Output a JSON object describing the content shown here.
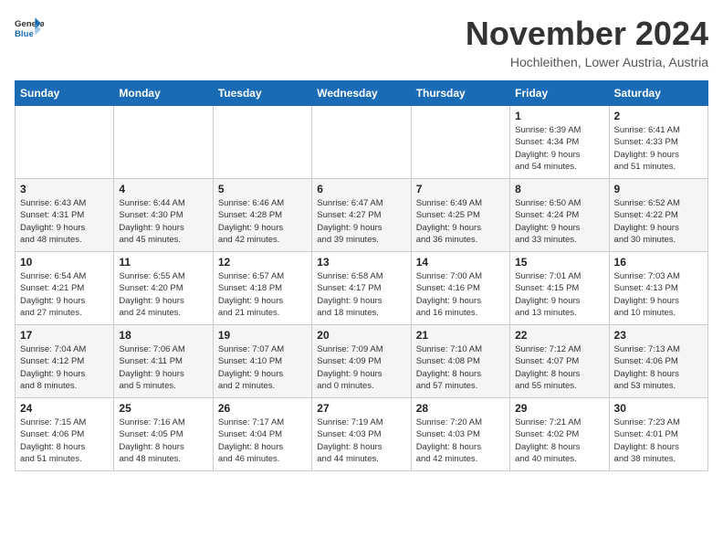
{
  "logo": {
    "line1": "General",
    "line2": "Blue"
  },
  "title": "November 2024",
  "location": "Hochleithen, Lower Austria, Austria",
  "weekdays": [
    "Sunday",
    "Monday",
    "Tuesday",
    "Wednesday",
    "Thursday",
    "Friday",
    "Saturday"
  ],
  "weeks": [
    [
      {
        "day": "",
        "info": ""
      },
      {
        "day": "",
        "info": ""
      },
      {
        "day": "",
        "info": ""
      },
      {
        "day": "",
        "info": ""
      },
      {
        "day": "",
        "info": ""
      },
      {
        "day": "1",
        "info": "Sunrise: 6:39 AM\nSunset: 4:34 PM\nDaylight: 9 hours\nand 54 minutes."
      },
      {
        "day": "2",
        "info": "Sunrise: 6:41 AM\nSunset: 4:33 PM\nDaylight: 9 hours\nand 51 minutes."
      }
    ],
    [
      {
        "day": "3",
        "info": "Sunrise: 6:43 AM\nSunset: 4:31 PM\nDaylight: 9 hours\nand 48 minutes."
      },
      {
        "day": "4",
        "info": "Sunrise: 6:44 AM\nSunset: 4:30 PM\nDaylight: 9 hours\nand 45 minutes."
      },
      {
        "day": "5",
        "info": "Sunrise: 6:46 AM\nSunset: 4:28 PM\nDaylight: 9 hours\nand 42 minutes."
      },
      {
        "day": "6",
        "info": "Sunrise: 6:47 AM\nSunset: 4:27 PM\nDaylight: 9 hours\nand 39 minutes."
      },
      {
        "day": "7",
        "info": "Sunrise: 6:49 AM\nSunset: 4:25 PM\nDaylight: 9 hours\nand 36 minutes."
      },
      {
        "day": "8",
        "info": "Sunrise: 6:50 AM\nSunset: 4:24 PM\nDaylight: 9 hours\nand 33 minutes."
      },
      {
        "day": "9",
        "info": "Sunrise: 6:52 AM\nSunset: 4:22 PM\nDaylight: 9 hours\nand 30 minutes."
      }
    ],
    [
      {
        "day": "10",
        "info": "Sunrise: 6:54 AM\nSunset: 4:21 PM\nDaylight: 9 hours\nand 27 minutes."
      },
      {
        "day": "11",
        "info": "Sunrise: 6:55 AM\nSunset: 4:20 PM\nDaylight: 9 hours\nand 24 minutes."
      },
      {
        "day": "12",
        "info": "Sunrise: 6:57 AM\nSunset: 4:18 PM\nDaylight: 9 hours\nand 21 minutes."
      },
      {
        "day": "13",
        "info": "Sunrise: 6:58 AM\nSunset: 4:17 PM\nDaylight: 9 hours\nand 18 minutes."
      },
      {
        "day": "14",
        "info": "Sunrise: 7:00 AM\nSunset: 4:16 PM\nDaylight: 9 hours\nand 16 minutes."
      },
      {
        "day": "15",
        "info": "Sunrise: 7:01 AM\nSunset: 4:15 PM\nDaylight: 9 hours\nand 13 minutes."
      },
      {
        "day": "16",
        "info": "Sunrise: 7:03 AM\nSunset: 4:13 PM\nDaylight: 9 hours\nand 10 minutes."
      }
    ],
    [
      {
        "day": "17",
        "info": "Sunrise: 7:04 AM\nSunset: 4:12 PM\nDaylight: 9 hours\nand 8 minutes."
      },
      {
        "day": "18",
        "info": "Sunrise: 7:06 AM\nSunset: 4:11 PM\nDaylight: 9 hours\nand 5 minutes."
      },
      {
        "day": "19",
        "info": "Sunrise: 7:07 AM\nSunset: 4:10 PM\nDaylight: 9 hours\nand 2 minutes."
      },
      {
        "day": "20",
        "info": "Sunrise: 7:09 AM\nSunset: 4:09 PM\nDaylight: 9 hours\nand 0 minutes."
      },
      {
        "day": "21",
        "info": "Sunrise: 7:10 AM\nSunset: 4:08 PM\nDaylight: 8 hours\nand 57 minutes."
      },
      {
        "day": "22",
        "info": "Sunrise: 7:12 AM\nSunset: 4:07 PM\nDaylight: 8 hours\nand 55 minutes."
      },
      {
        "day": "23",
        "info": "Sunrise: 7:13 AM\nSunset: 4:06 PM\nDaylight: 8 hours\nand 53 minutes."
      }
    ],
    [
      {
        "day": "24",
        "info": "Sunrise: 7:15 AM\nSunset: 4:06 PM\nDaylight: 8 hours\nand 51 minutes."
      },
      {
        "day": "25",
        "info": "Sunrise: 7:16 AM\nSunset: 4:05 PM\nDaylight: 8 hours\nand 48 minutes."
      },
      {
        "day": "26",
        "info": "Sunrise: 7:17 AM\nSunset: 4:04 PM\nDaylight: 8 hours\nand 46 minutes."
      },
      {
        "day": "27",
        "info": "Sunrise: 7:19 AM\nSunset: 4:03 PM\nDaylight: 8 hours\nand 44 minutes."
      },
      {
        "day": "28",
        "info": "Sunrise: 7:20 AM\nSunset: 4:03 PM\nDaylight: 8 hours\nand 42 minutes."
      },
      {
        "day": "29",
        "info": "Sunrise: 7:21 AM\nSunset: 4:02 PM\nDaylight: 8 hours\nand 40 minutes."
      },
      {
        "day": "30",
        "info": "Sunrise: 7:23 AM\nSunset: 4:01 PM\nDaylight: 8 hours\nand 38 minutes."
      }
    ]
  ]
}
